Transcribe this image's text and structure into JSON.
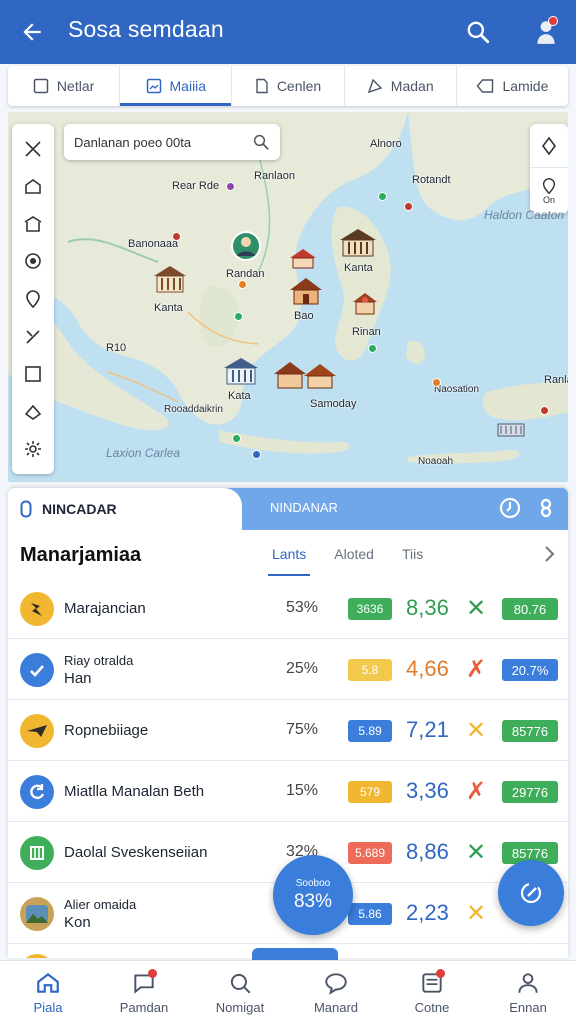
{
  "header": {
    "title": "Sosa semdaan"
  },
  "tabs": [
    {
      "label": "Netlar",
      "icon": "square-icon"
    },
    {
      "label": "Maiiia",
      "icon": "image-icon"
    },
    {
      "label": "Cenlen",
      "icon": "document-icon"
    },
    {
      "label": "Madan",
      "icon": "tag-icon"
    },
    {
      "label": "Lamide",
      "icon": "label-icon"
    }
  ],
  "map": {
    "search_text": "Danlanan poeo 00ta",
    "control_label": "On",
    "places": {
      "p1": "Alnoro",
      "p2": "Ranlaon",
      "p3": "Rotandt",
      "p4": "Rear Rde",
      "p5": "Banonaaa",
      "p6": "Randan",
      "p7": "Kanta",
      "p8": "Kanta",
      "p9": "Bao",
      "p10": "Rinan",
      "p11": "R10",
      "p12": "Kata",
      "p13": "Samoday",
      "p14": "Rooaddaikrin",
      "p15": "Naosation",
      "p16": "Ranlan",
      "p17": "Noaoah",
      "sea1": "Haldon Caaton Laedo",
      "sea2": "Laxion Carlea"
    }
  },
  "sheet": {
    "head_left": "NINCADAR",
    "head_mid": "NINDANAR",
    "section_title": "Manarjamiaa",
    "subtabs": [
      "Lants",
      "Aloted",
      "Tiis"
    ],
    "rows": [
      {
        "name": "Marajancian",
        "name2": "",
        "pct": "53%",
        "chip": "3636",
        "chip_color": "#3fae5b",
        "value": "8,36",
        "value_color": "#2f9e4f",
        "mark": "✕",
        "mark_color": "#2f9e4f",
        "pill": "80.76",
        "pill_color": "#3fae5b",
        "icon": "bolt-icon",
        "icon_bg": "#f2b731"
      },
      {
        "name": "Riay otralda",
        "name2": "Han",
        "pct": "25%",
        "chip": "5.8",
        "chip_color": "#f2c94c",
        "value": "4,66",
        "value_color": "#e07b2c",
        "mark": "✗",
        "mark_color": "#e65d3c",
        "pill": "20.7%",
        "pill_color": "#3b7ddb",
        "icon": "check-icon",
        "icon_bg": "#3b7ddb"
      },
      {
        "name": "Ropnebiiage",
        "name2": "",
        "pct": "75%",
        "chip": "5.89",
        "chip_color": "#3b7ddb",
        "value": "7,21",
        "value_color": "#2f67c2",
        "mark": "✕",
        "mark_color": "#f2b731",
        "pill": "85776",
        "pill_color": "#3fae5b",
        "icon": "plane-icon",
        "icon_bg": "#f2b731"
      },
      {
        "name": "Miatlla Manalan Beth",
        "name2": "",
        "pct": "15%",
        "chip": "579",
        "chip_color": "#f2b731",
        "value": "3,36",
        "value_color": "#2f67c2",
        "mark": "✗",
        "mark_color": "#e65d3c",
        "pill": "29776",
        "pill_color": "#3fae5b",
        "icon": "refresh-icon",
        "icon_bg": "#3b7ddb"
      },
      {
        "name": "Daolal Sveskenseiian",
        "name2": "",
        "pct": "32%",
        "chip": "5.689",
        "chip_color": "#ee6b5a",
        "value": "8,86",
        "value_color": "#2f67c2",
        "mark": "✕",
        "mark_color": "#2f9e4f",
        "pill": "85776",
        "pill_color": "#3fae5b",
        "icon": "building-icon",
        "icon_bg": "#3fae5b"
      },
      {
        "name": "Alier omaida",
        "name2": "Kon",
        "pct": "",
        "chip": "5.86",
        "chip_color": "#3b7ddb",
        "value": "2,23",
        "value_color": "#2f67c2",
        "mark": "✕",
        "mark_color": "#f2b731",
        "pill": "",
        "pill_color": "#3fae5b",
        "icon": "landscape-icon",
        "icon_bg": "#c9a25a"
      }
    ]
  },
  "fab": {
    "line1": "Sooboo",
    "line2": "83%"
  },
  "bottom_nav": [
    {
      "label": "Piala",
      "icon": "home-icon",
      "badge": false
    },
    {
      "label": "Pamdan",
      "icon": "chat-icon",
      "badge": true
    },
    {
      "label": "Nomigat",
      "icon": "headset-icon",
      "badge": false
    },
    {
      "label": "Manard",
      "icon": "bubble-icon",
      "badge": false
    },
    {
      "label": "Cotne",
      "icon": "inbox-icon",
      "badge": true
    },
    {
      "label": "Ennan",
      "icon": "person-icon",
      "badge": false
    }
  ]
}
